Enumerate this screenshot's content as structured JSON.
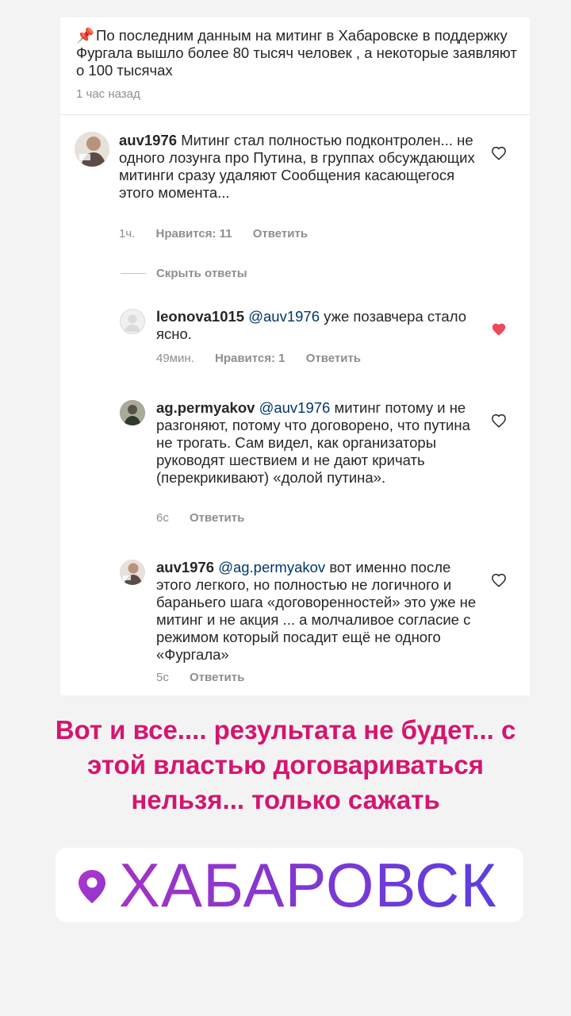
{
  "post": {
    "pin_emoji": "📌",
    "caption": "По последним данным на митинг в Хабаровске в поддержку Фургала вышло более 80 тысяч человек , а некоторые заявляют о 100 тысячах",
    "time": "1 час назад"
  },
  "comments": [
    {
      "username": "auv1976",
      "mention": "",
      "text": "Митинг стал полностью подконтролен... не одного лозунга про Путина, в группах обсуждающих митинги сразу удаляют Сообщения касающегося этого момента...",
      "time": "1ч.",
      "likes": "Нравится: 11",
      "reply": "Ответить",
      "liked": false
    },
    {
      "username": "leonova1015",
      "mention": "@auv1976",
      "text": "уже позавчера стало ясно.",
      "time": "49мин.",
      "likes": "Нравится: 1",
      "reply": "Ответить",
      "liked": true
    },
    {
      "username": "ag.permyakov",
      "mention": "@auv1976",
      "text": "митинг потому и не разгоняют, потому что договорено, что путина не трогать. Сам видел, как организаторы руководят шествием и не дают кричать (перекрикивают) «долой путина».",
      "time": "6с",
      "reply": "Ответить",
      "liked": false
    },
    {
      "username": "auv1976",
      "mention": "@ag.permyakov",
      "text": "вот именно после этого легкого, но полностью не логичного и бараньего шага «договоренностей» это уже не митинг и не акция ... а молчаливое согласие с режимом который посадит ещё не одного «Фургала»",
      "time": "5с",
      "reply": "Ответить",
      "liked": false
    }
  ],
  "hide_replies": "Скрыть ответы",
  "headline": "Вот и все.... результата не будет... с этой властью договариваться нельзя... только сажать",
  "location": {
    "name": "ХАБАРОВСК",
    "icon": "location-pin-icon"
  },
  "colors": {
    "headline": "#d5156e",
    "liked_heart": "#ed4956",
    "mention": "#00376b",
    "location_gradient": [
      "#a233c4",
      "#5b3ee0"
    ]
  }
}
